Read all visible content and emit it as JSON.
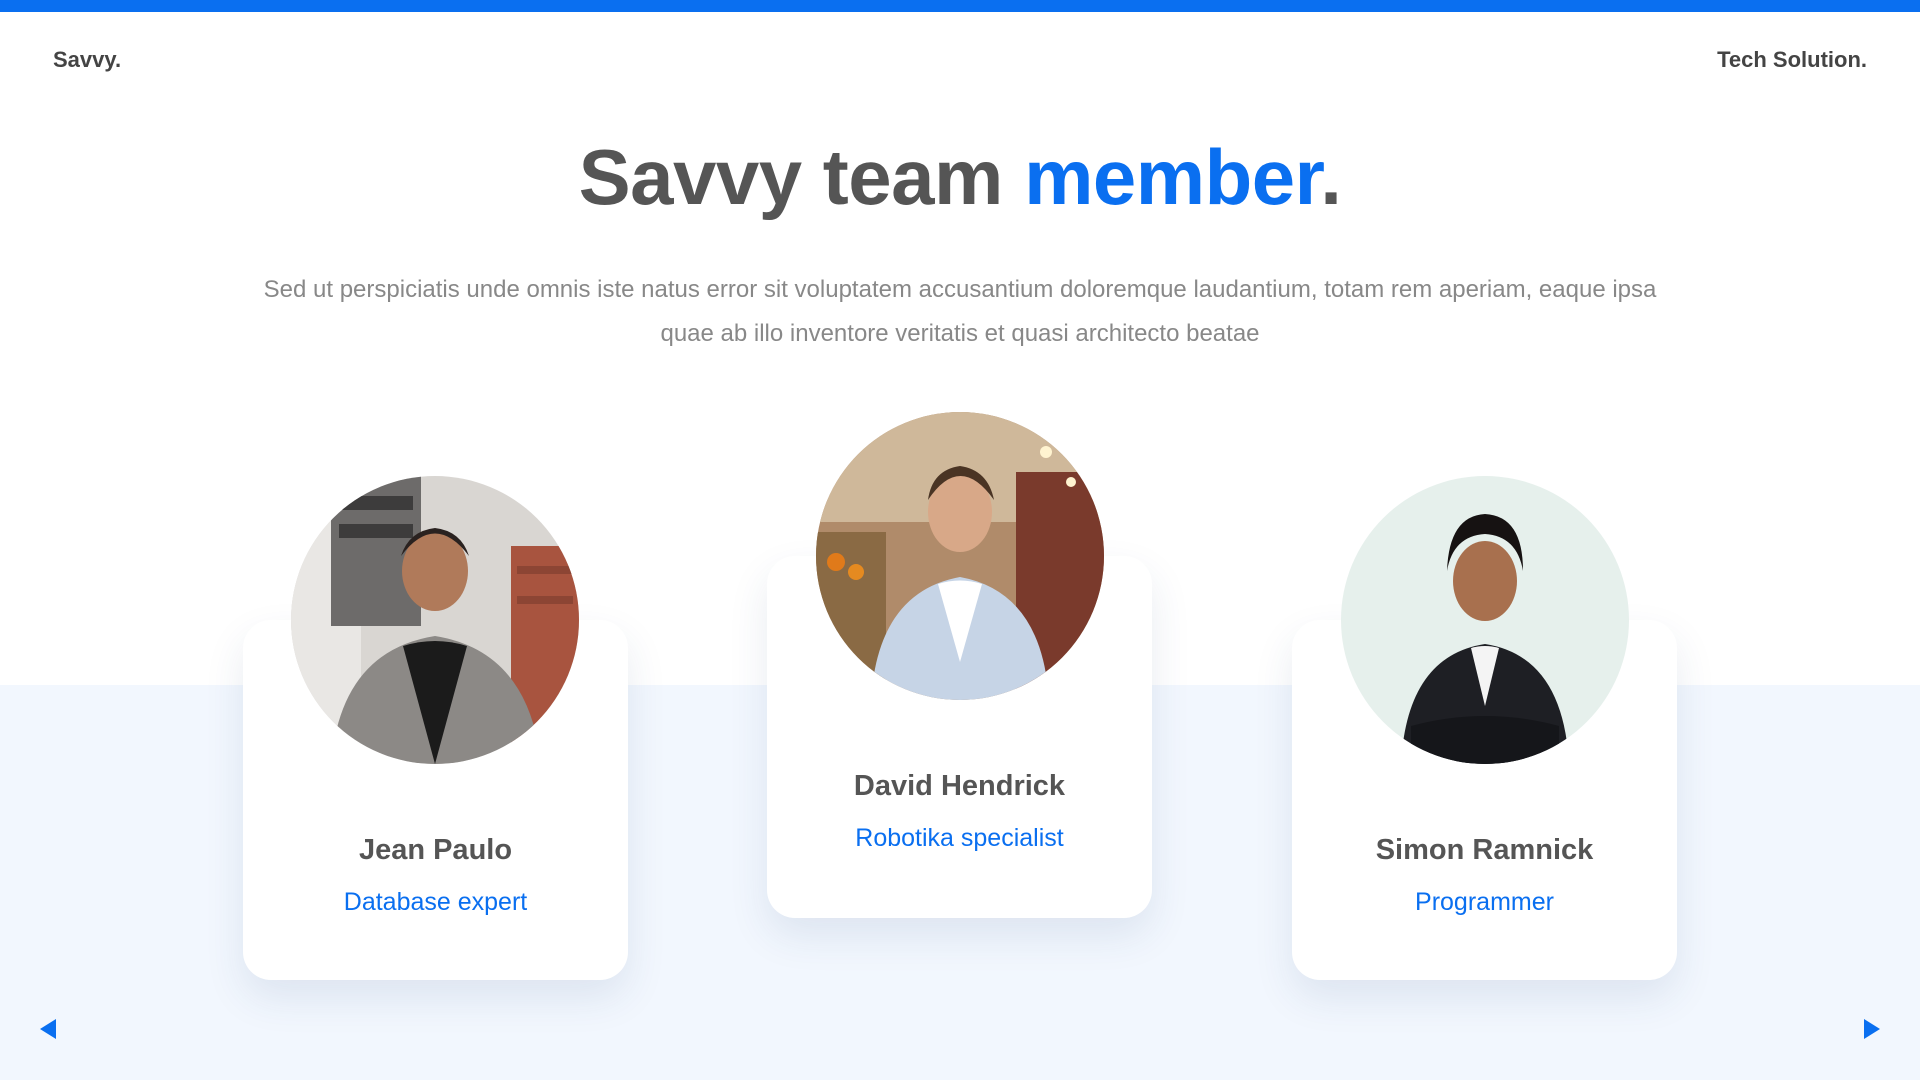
{
  "header": {
    "brand_left": "Savvy.",
    "brand_right": "Tech Solution."
  },
  "hero": {
    "title_main": "Savvy team ",
    "title_accent": "member",
    "title_dot": ".",
    "subtitle": "Sed ut perspiciatis unde omnis iste natus error sit voluptatem accusantium doloremque laudantium, totam rem aperiam, eaque ipsa quae ab illo inventore veritatis et quasi architecto beatae"
  },
  "team": [
    {
      "name": "Jean Paulo",
      "role": "Database expert"
    },
    {
      "name": "David Hendrick",
      "role": "Robotika specialist"
    },
    {
      "name": "Simon Ramnick",
      "role": "Programmer"
    }
  ],
  "nav": {
    "prev_icon": "triangle-left-icon",
    "next_icon": "triangle-right-icon"
  },
  "colors": {
    "accent": "#0a6ff0",
    "text": "#555555",
    "muted": "#888888",
    "band": "#f2f7fe"
  }
}
